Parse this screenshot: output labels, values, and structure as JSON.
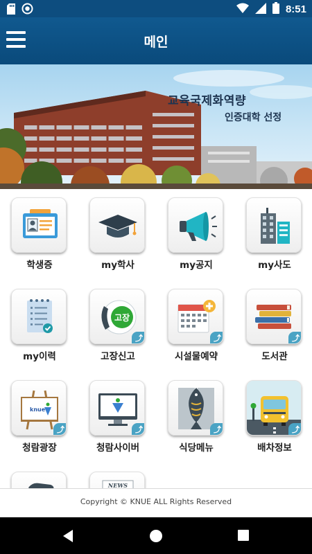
{
  "status_bar": {
    "time": "8:51",
    "icons": [
      "sd-card-icon",
      "dnd-circle-icon",
      "wifi-icon",
      "signal-icon",
      "battery-icon"
    ]
  },
  "app_bar": {
    "title": "메인",
    "menu_icon": "hamburger-menu-icon"
  },
  "banner": {
    "line1": "교육국제화역량",
    "line2": "인증대학 선정"
  },
  "menu_grid": [
    {
      "label": "학생증",
      "icon": "student-id-card-icon",
      "external": false
    },
    {
      "label": "my학사",
      "icon": "graduation-cap-icon",
      "external": false
    },
    {
      "label": "my공지",
      "icon": "megaphone-icon",
      "external": false
    },
    {
      "label": "my사도",
      "icon": "building-icon",
      "external": false
    },
    {
      "label": "my이력",
      "icon": "checklist-icon",
      "external": false
    },
    {
      "label": "고장신고",
      "icon": "phone-repair-icon",
      "external": true,
      "badge_text": "고장"
    },
    {
      "label": "시설물예약",
      "icon": "calendar-add-icon",
      "external": true
    },
    {
      "label": "도서관",
      "icon": "books-icon",
      "external": true
    },
    {
      "label": "청람광장",
      "icon": "easel-logo-icon",
      "external": true
    },
    {
      "label": "청람사이버",
      "icon": "monitor-logo-icon",
      "external": true
    },
    {
      "label": "식당메뉴",
      "icon": "fish-icon",
      "external": true
    },
    {
      "label": "배차정보",
      "icon": "bus-icon",
      "external": true
    },
    {
      "label": "",
      "icon": "phone-icon",
      "external": false
    },
    {
      "label": "",
      "icon": "newspaper-icon",
      "external": false,
      "badge_text": "NEWS"
    }
  ],
  "footer": {
    "copyright": "Copyright © KNUE ALL Rights Reserved"
  },
  "nav_bar": {
    "buttons": [
      "back-icon",
      "home-icon",
      "recents-icon"
    ]
  },
  "colors": {
    "app_bar": "#0d4d7f",
    "external_badge": "#4aa3c4"
  }
}
